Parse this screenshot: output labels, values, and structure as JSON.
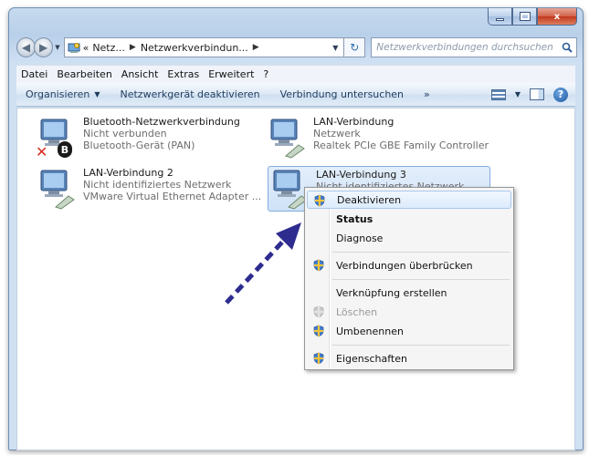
{
  "window": {
    "caption_buttons": {
      "minimize": "–",
      "maximize": "",
      "close": "x"
    }
  },
  "address": {
    "back_glyph": "◀",
    "forward_glyph": "▶",
    "crumb_overflow": "«",
    "crumb_1": "Netz...",
    "crumb_2": "Netzwerkverbindun...",
    "refresh_glyph": "↻",
    "search_placeholder": "Netzwerkverbindungen durchsuchen"
  },
  "menubar": {
    "items": [
      "Datei",
      "Bearbeiten",
      "Ansicht",
      "Extras",
      "Erweitert",
      "?"
    ]
  },
  "cmdbar": {
    "organize": "Organisieren",
    "disable_device": "Netzwerkgerät deaktivieren",
    "diagnose_connection": "Verbindung untersuchen",
    "more": "»",
    "help": "?"
  },
  "connections": [
    {
      "name": "Bluetooth-Netzwerkverbindung",
      "status": "Nicht verbunden",
      "device": "Bluetooth-Gerät (PAN)"
    },
    {
      "name": "LAN-Verbindung",
      "status": "Netzwerk",
      "device": "Realtek PCIe GBE Family Controller"
    },
    {
      "name": "LAN-Verbindung 2",
      "status": "Nicht identifiziertes Netzwerk",
      "device": "VMware Virtual Ethernet Adapter ..."
    },
    {
      "name": "LAN-Verbindung 3",
      "status": "Nicht identifiziertes Netzwerk",
      "device": ""
    }
  ],
  "context_menu": {
    "items": [
      {
        "label": "Deaktivieren",
        "icon": "shield-icon"
      },
      {
        "label": "Status"
      },
      {
        "label": "Diagnose"
      },
      {
        "label": "Verbindungen überbrücken",
        "icon": "shield-icon"
      },
      {
        "label": "Verknüpfung erstellen"
      },
      {
        "label": "Löschen",
        "icon": "shield-icon"
      },
      {
        "label": "Umbenennen",
        "icon": "shield-icon"
      },
      {
        "label": "Eigenschaften",
        "icon": "shield-icon"
      }
    ]
  },
  "colors": {
    "annotation_arrow": "#2f2c8f",
    "selection": "#cfe2f8",
    "disabled_connection_mark": "#d82b1f",
    "bluetooth_badge": "#1a1a1a"
  }
}
